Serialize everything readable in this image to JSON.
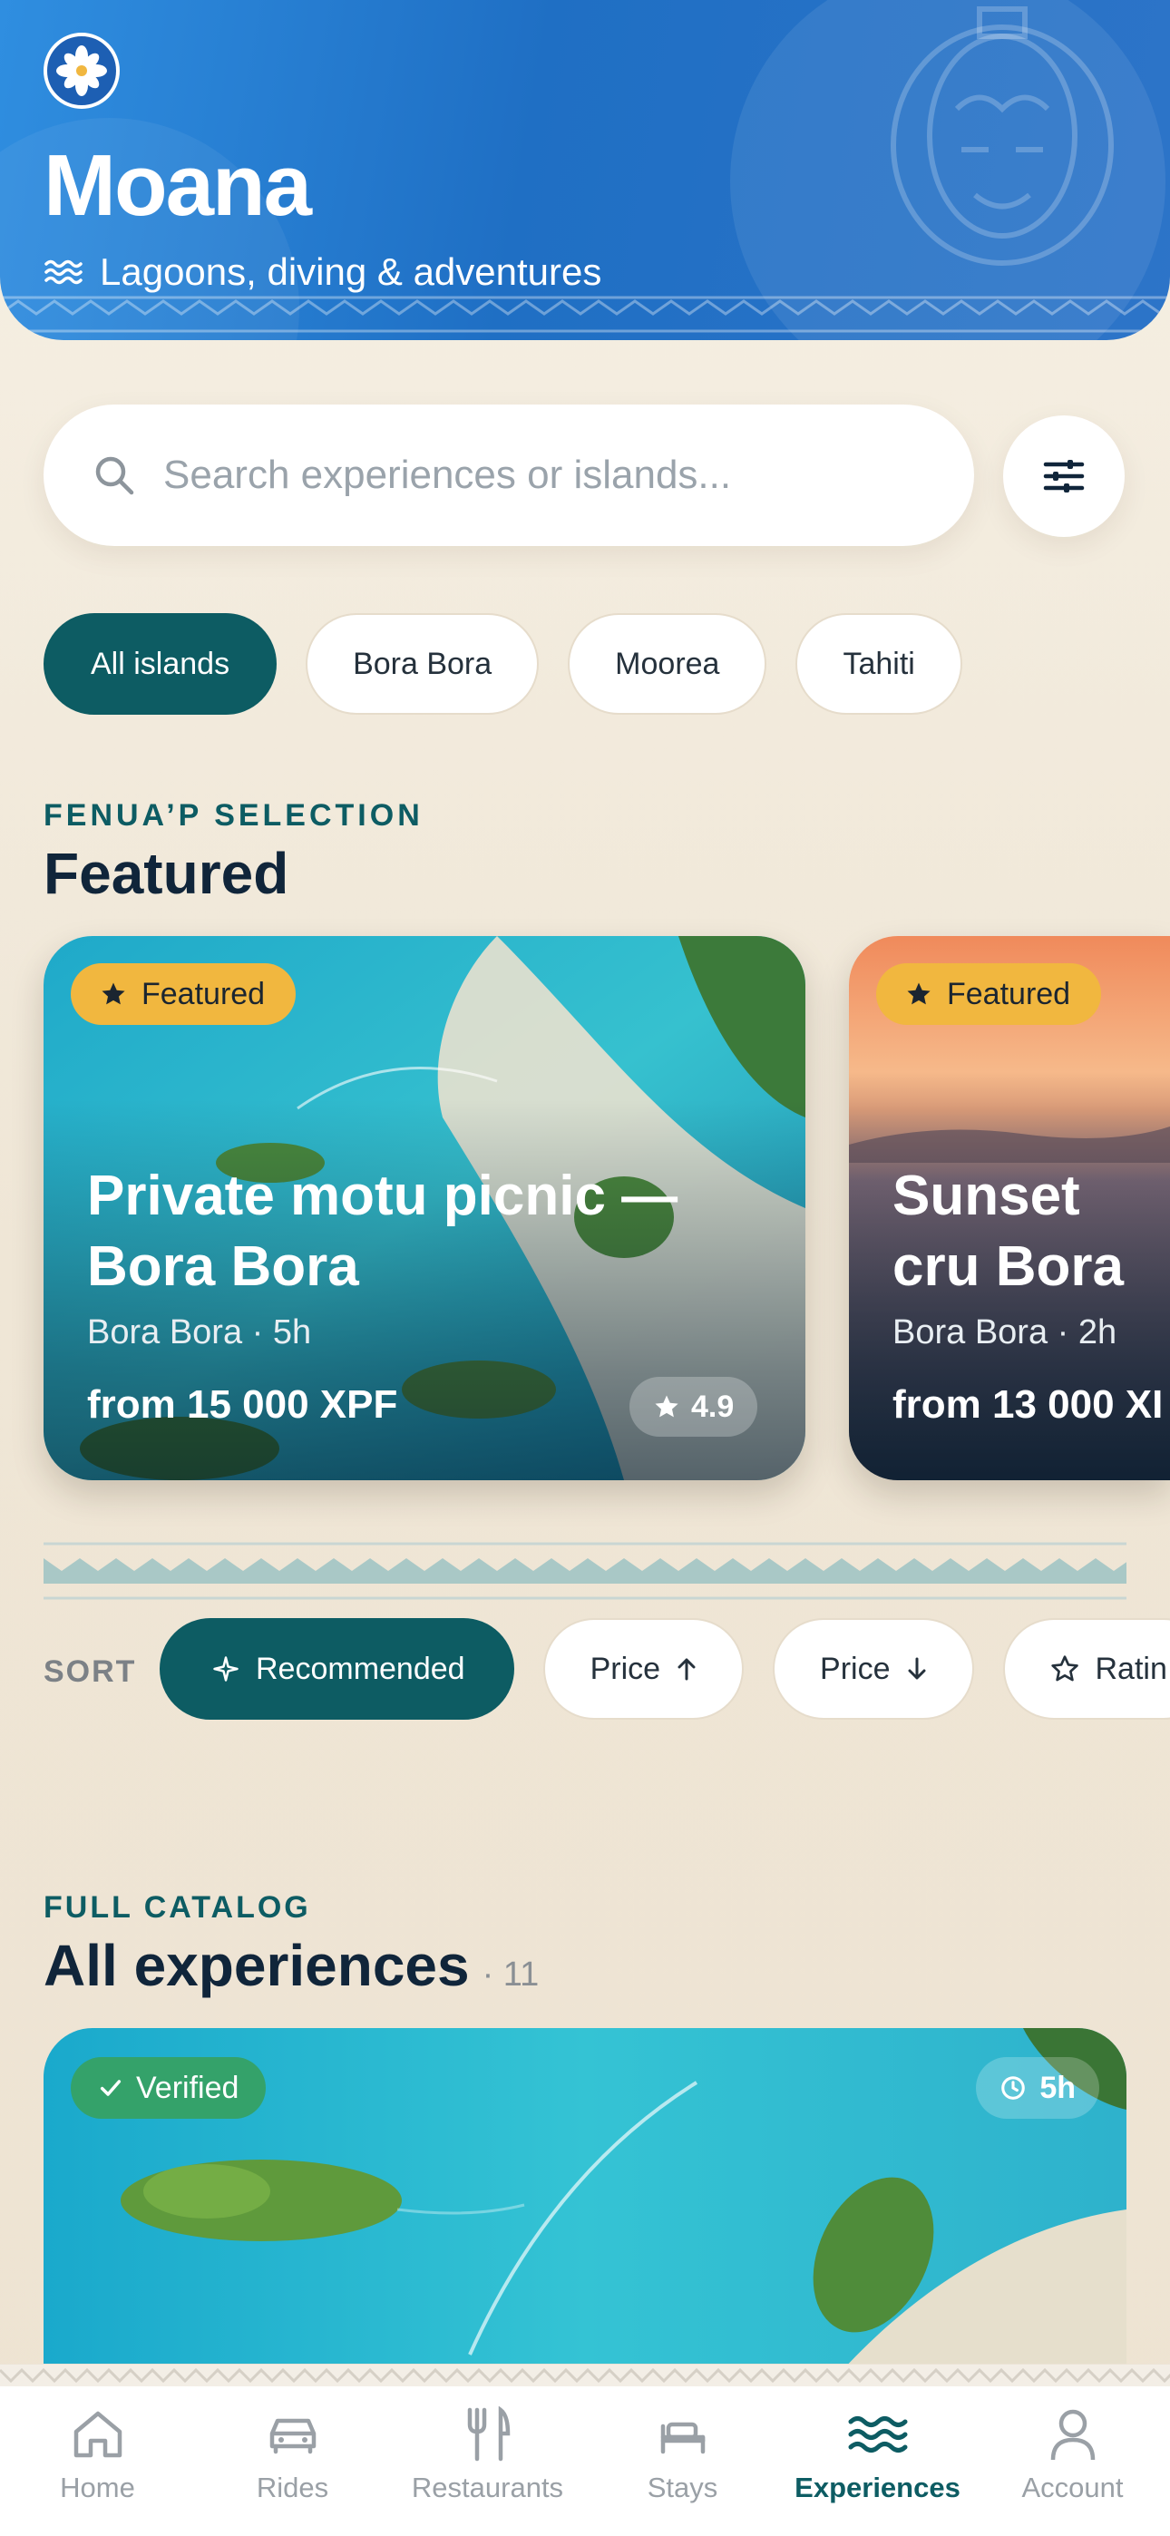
{
  "header": {
    "title": "Moana",
    "tagline": "Lagoons, diving & adventures"
  },
  "search": {
    "placeholder": "Search experiences or islands..."
  },
  "island_filters": [
    {
      "label": "All islands",
      "active": true
    },
    {
      "label": "Bora Bora",
      "active": false
    },
    {
      "label": "Moorea",
      "active": false
    },
    {
      "label": "Tahiti",
      "active": false
    }
  ],
  "featured_section": {
    "eyebrow": "FENUA’P SELECTION",
    "title": "Featured",
    "cards": [
      {
        "badge": "Featured",
        "title": "Private motu picnic — Bora Bora",
        "meta": "Bora Bora · 5h",
        "price": "from 15 000 XPF",
        "rating": "4.9"
      },
      {
        "badge": "Featured",
        "title": "Sunset cru Bora",
        "meta": "Bora Bora · 2h",
        "price": "from 13 000 XI"
      }
    ]
  },
  "sort": {
    "label": "SORT",
    "options": [
      {
        "label": "Recommended",
        "active": true,
        "icon": "sparkle-icon"
      },
      {
        "label": "Price",
        "active": false,
        "icon": "arrow-up-icon"
      },
      {
        "label": "Price",
        "active": false,
        "icon": "arrow-down-icon"
      },
      {
        "label": "Ratin",
        "active": false,
        "icon": "star-outline-icon"
      }
    ]
  },
  "catalog_section": {
    "eyebrow": "FULL CATALOG",
    "title": "All experiences",
    "count": "· 11",
    "first_card": {
      "badge": "Verified",
      "duration": "5h"
    }
  },
  "tabbar": [
    {
      "label": "Home",
      "icon": "home-icon",
      "active": false
    },
    {
      "label": "Rides",
      "icon": "car-icon",
      "active": false
    },
    {
      "label": "Restaurants",
      "icon": "fork-knife-icon",
      "active": false
    },
    {
      "label": "Stays",
      "icon": "bed-icon",
      "active": false
    },
    {
      "label": "Experiences",
      "icon": "waves-icon",
      "active": true
    },
    {
      "label": "Account",
      "icon": "person-icon",
      "active": false
    }
  ],
  "colors": {
    "primary": "#0d5c63",
    "header_blue": "#1f6fc4",
    "featured_badge": "#f1b73f",
    "verified_badge": "#34a26a",
    "background": "#f4ede1"
  }
}
